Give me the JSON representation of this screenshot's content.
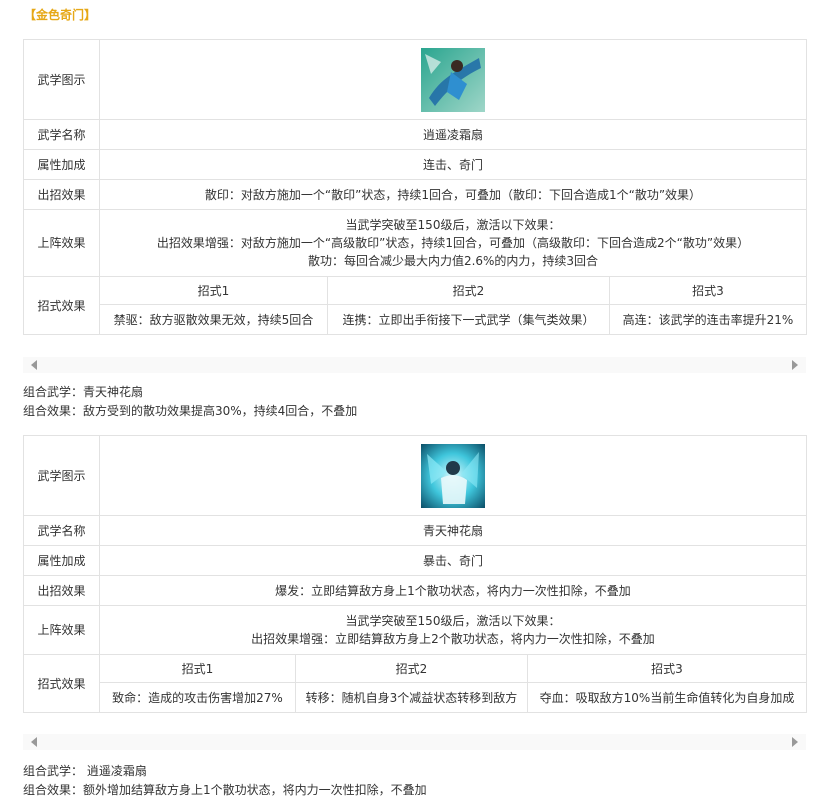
{
  "heading": "【金色奇门】",
  "labels": {
    "icon": "武学图示",
    "name": "武学名称",
    "attr": "属性加成",
    "effect": "出招效果",
    "lineup": "上阵效果",
    "moves": "招式效果"
  },
  "skills": [
    {
      "name": "逍遥凌霜扇",
      "attr": "连击、奇门",
      "effect": "散印：对敌方施加一个“散印”状态，持续1回合，可叠加（散印：下回合造成1个“散功”效果）",
      "lineup": [
        "当武学突破至150级后，激活以下效果：",
        "出招效果增强：对敌方施加一个“高级散印”状态，持续1回合，可叠加（高级散印：下回合造成2个“散功”效果）",
        "散功：每回合减少最大内力值2.6%的内力，持续3回合"
      ],
      "move_heads": [
        "招式1",
        "招式2",
        "招式3"
      ],
      "moves": [
        "禁驱：敌方驱散效果无效，持续5回合",
        "连携：立即出手衔接下一式武学（集气类效果）",
        "高连：该武学的连击率提升21%"
      ],
      "combo_skill": "组合武学：青天神花扇",
      "combo_effect": "组合效果：敌方受到的散功效果提高30%，持续4回合，不叠加"
    },
    {
      "name": "青天神花扇",
      "attr": "暴击、奇门",
      "effect": "爆发：立即结算敌方身上1个散功状态，将内力一次性扣除，不叠加",
      "lineup": [
        "当武学突破至150级后，激活以下效果：",
        "出招效果增强：立即结算敌方身上2个散功状态，将内力一次性扣除，不叠加"
      ],
      "move_heads": [
        "招式1",
        "招式2",
        "招式3"
      ],
      "moves": [
        "致命：造成的攻击伤害增加27%",
        "转移：随机自身3个减益状态转移到敌方",
        "夺血：吸取敌方10%当前生命值转化为自身加成"
      ],
      "combo_skill": "组合武学： 逍遥凌霜扇",
      "combo_effect": "组合效果：额外增加结算敌方身上1个散功状态，将内力一次性扣除，不叠加"
    }
  ],
  "colors": {
    "heading": "#e6a817",
    "border": "#e2e2e2",
    "text": "#333333"
  }
}
